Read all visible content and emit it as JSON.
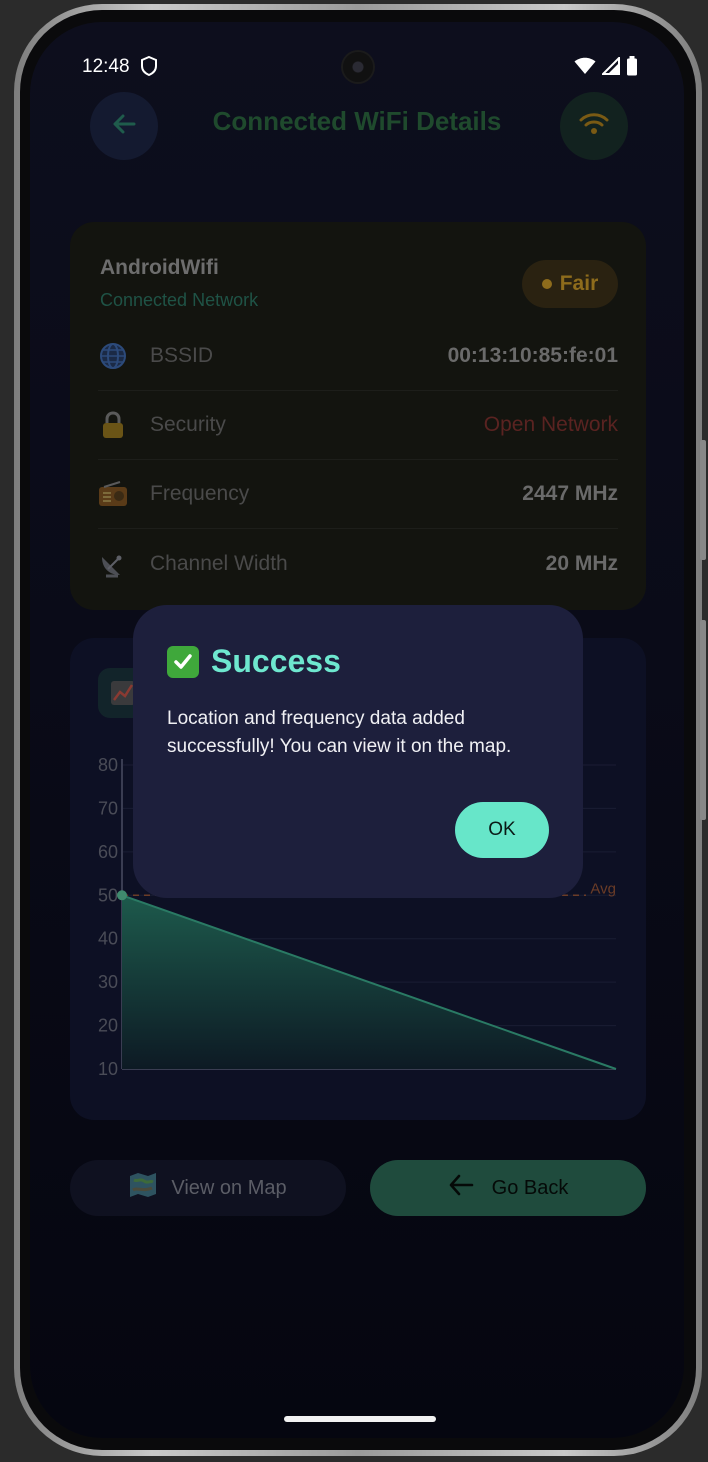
{
  "status_bar": {
    "time": "12:48"
  },
  "header": {
    "title": "Connected WiFi Details"
  },
  "network": {
    "name": "AndroidWifi",
    "subtitle": "Connected Network",
    "quality_badge": "Fair",
    "rows": [
      {
        "icon": "globe-icon",
        "label": "BSSID",
        "value": "00:13:10:85:fe:01"
      },
      {
        "icon": "lock-icon",
        "label": "Security",
        "value": "Open Network"
      },
      {
        "icon": "radio-icon",
        "label": "Frequency",
        "value": "2447 MHz"
      },
      {
        "icon": "satellite-dish-icon",
        "label": "Channel Width",
        "value": "20 MHz"
      }
    ]
  },
  "chart_data": {
    "type": "area",
    "y_ticks": [
      "80",
      "70",
      "60",
      "50",
      "40",
      "30",
      "20",
      "10"
    ],
    "ylim": [
      10,
      80
    ],
    "x": [
      0,
      1
    ],
    "values": [
      50,
      10
    ],
    "avg_label": "Avg",
    "avg_value": 50,
    "grid": true
  },
  "actions": {
    "map_label": "View on Map",
    "back_label": "Go Back"
  },
  "dialog": {
    "title": "Success",
    "message": "Location and frequency data added successfully! You can view it on the map.",
    "ok_label": "OK"
  },
  "colors": {
    "accent": "#67e6c9",
    "dialog_bg": "#1d1f3c",
    "warning": "#8e6c1c"
  }
}
